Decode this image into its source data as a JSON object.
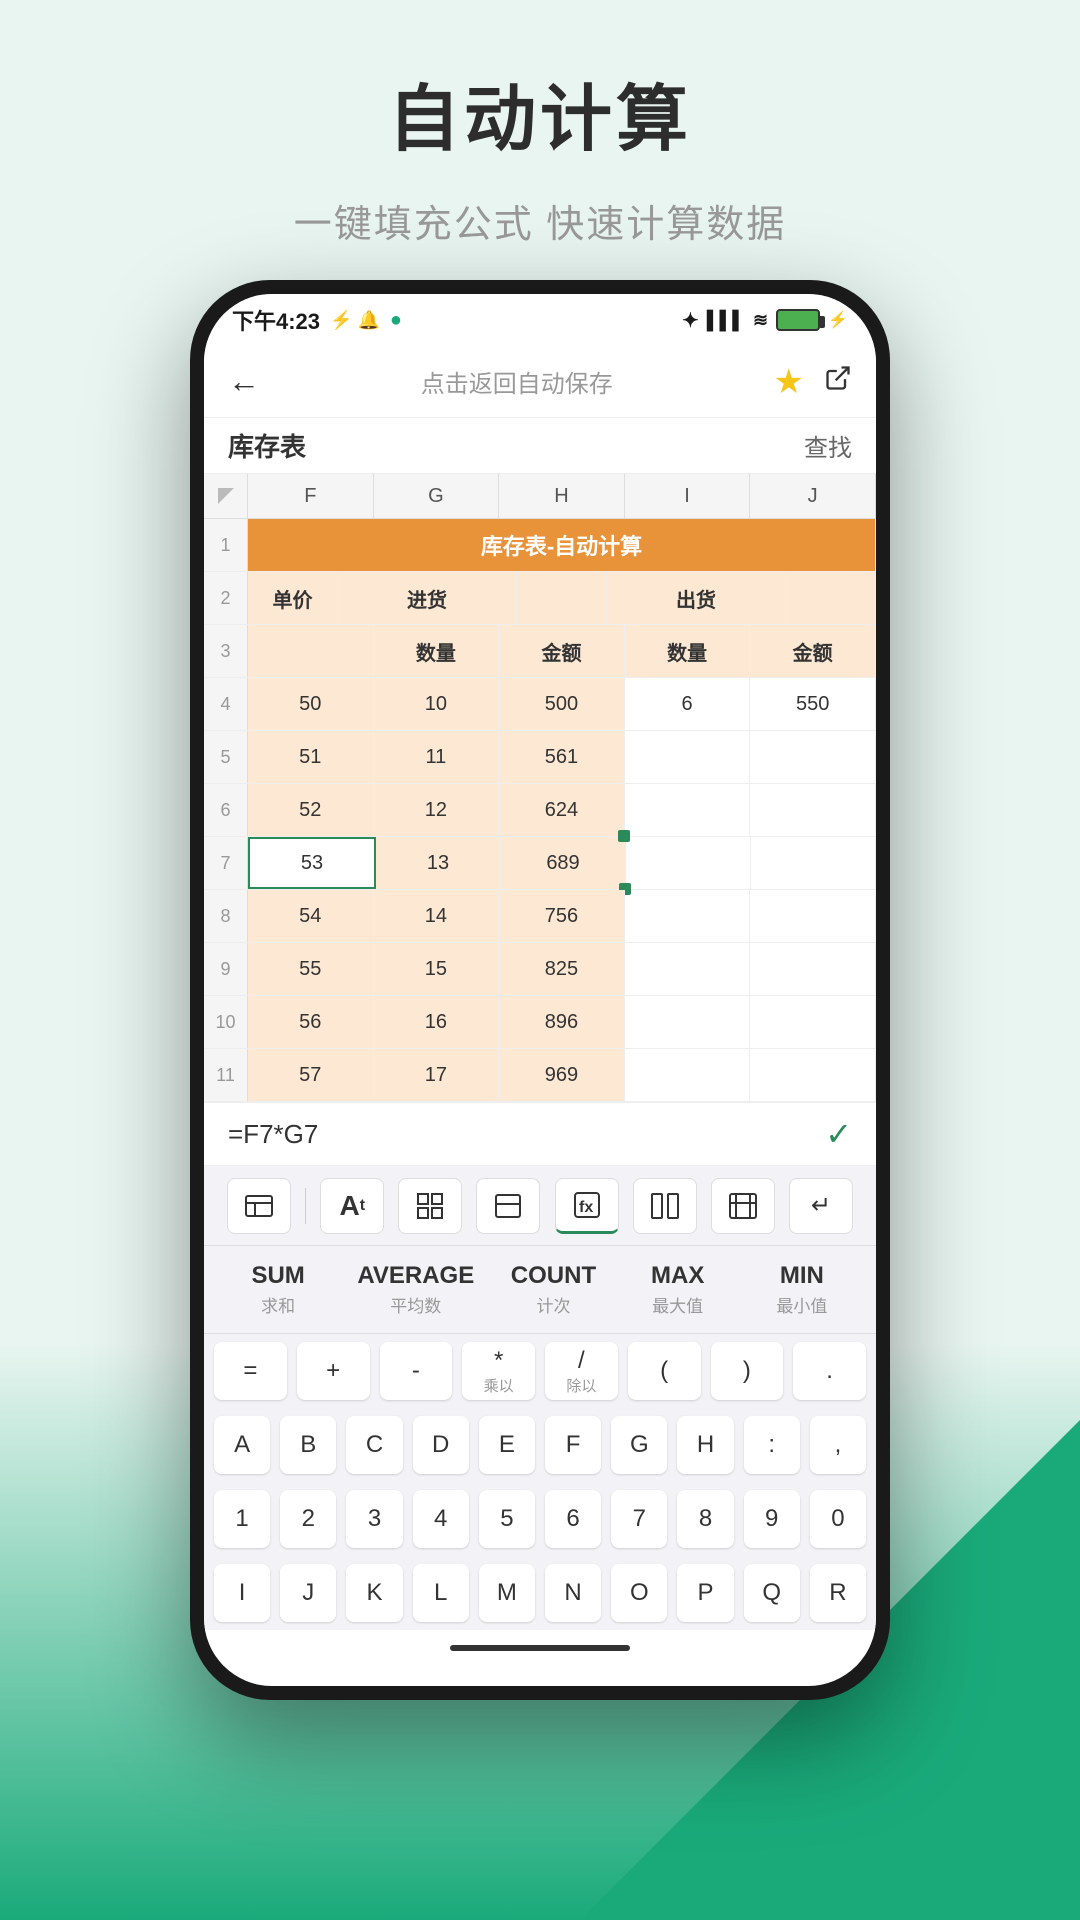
{
  "page": {
    "title": "自动计算",
    "subtitle": "一键填充公式 快速计算数据"
  },
  "status_bar": {
    "time": "下午4:23",
    "icons": "⚡ 🔔 ⊙",
    "right": "🔵 📶 📶 📶 🔋"
  },
  "nav": {
    "back": "←",
    "center": "点击返回自动保存",
    "star": "★",
    "share": "⬆"
  },
  "toolbar": {
    "title": "库存表",
    "find": "查找"
  },
  "spreadsheet": {
    "col_headers": [
      "F",
      "G",
      "H",
      "I",
      "J"
    ],
    "merged_title": "库存表-自动计算",
    "sub_headers_row2": [
      "单价",
      "进货",
      "",
      "出货",
      ""
    ],
    "sub_headers_row3": [
      "",
      "数量",
      "金额",
      "数量",
      "金额"
    ],
    "rows": [
      {
        "num": "4",
        "cells": [
          "50",
          "10",
          "500",
          "6",
          "550"
        ]
      },
      {
        "num": "5",
        "cells": [
          "51",
          "11",
          "561",
          "",
          ""
        ]
      },
      {
        "num": "6",
        "cells": [
          "52",
          "12",
          "624",
          "",
          ""
        ]
      },
      {
        "num": "7",
        "cells": [
          "53",
          "13",
          "689",
          "",
          ""
        ],
        "selected_col": 0
      },
      {
        "num": "8",
        "cells": [
          "54",
          "14",
          "756",
          "",
          ""
        ]
      },
      {
        "num": "9",
        "cells": [
          "55",
          "15",
          "825",
          "",
          ""
        ]
      },
      {
        "num": "10",
        "cells": [
          "56",
          "16",
          "896",
          "",
          ""
        ]
      },
      {
        "num": "11",
        "cells": [
          "57",
          "17",
          "969",
          "",
          ""
        ]
      }
    ]
  },
  "formula_bar": {
    "formula": "=F7*G7",
    "check": "✓"
  },
  "keyboard": {
    "functions": [
      {
        "name": "SUM",
        "sub": "求和"
      },
      {
        "name": "AVERAGE",
        "sub": "平均数"
      },
      {
        "name": "COUNT",
        "sub": "计次"
      },
      {
        "name": "MAX",
        "sub": "最大值"
      },
      {
        "name": "MIN",
        "sub": "最小值"
      }
    ],
    "operators": [
      "=",
      "+",
      "-",
      "*\n乘以",
      "/\n除以",
      "(",
      ")",
      "."
    ],
    "letters_row1": [
      "A",
      "B",
      "C",
      "D",
      "E",
      "F",
      "G",
      "H",
      ":",
      ","
    ],
    "numbers_row": [
      "1",
      "2",
      "3",
      "4",
      "5",
      "6",
      "7",
      "8",
      "9",
      "0"
    ],
    "letters_row2": [
      "I",
      "J",
      "K",
      "L",
      "M",
      "N",
      "O",
      "P",
      "Q",
      "R"
    ]
  }
}
